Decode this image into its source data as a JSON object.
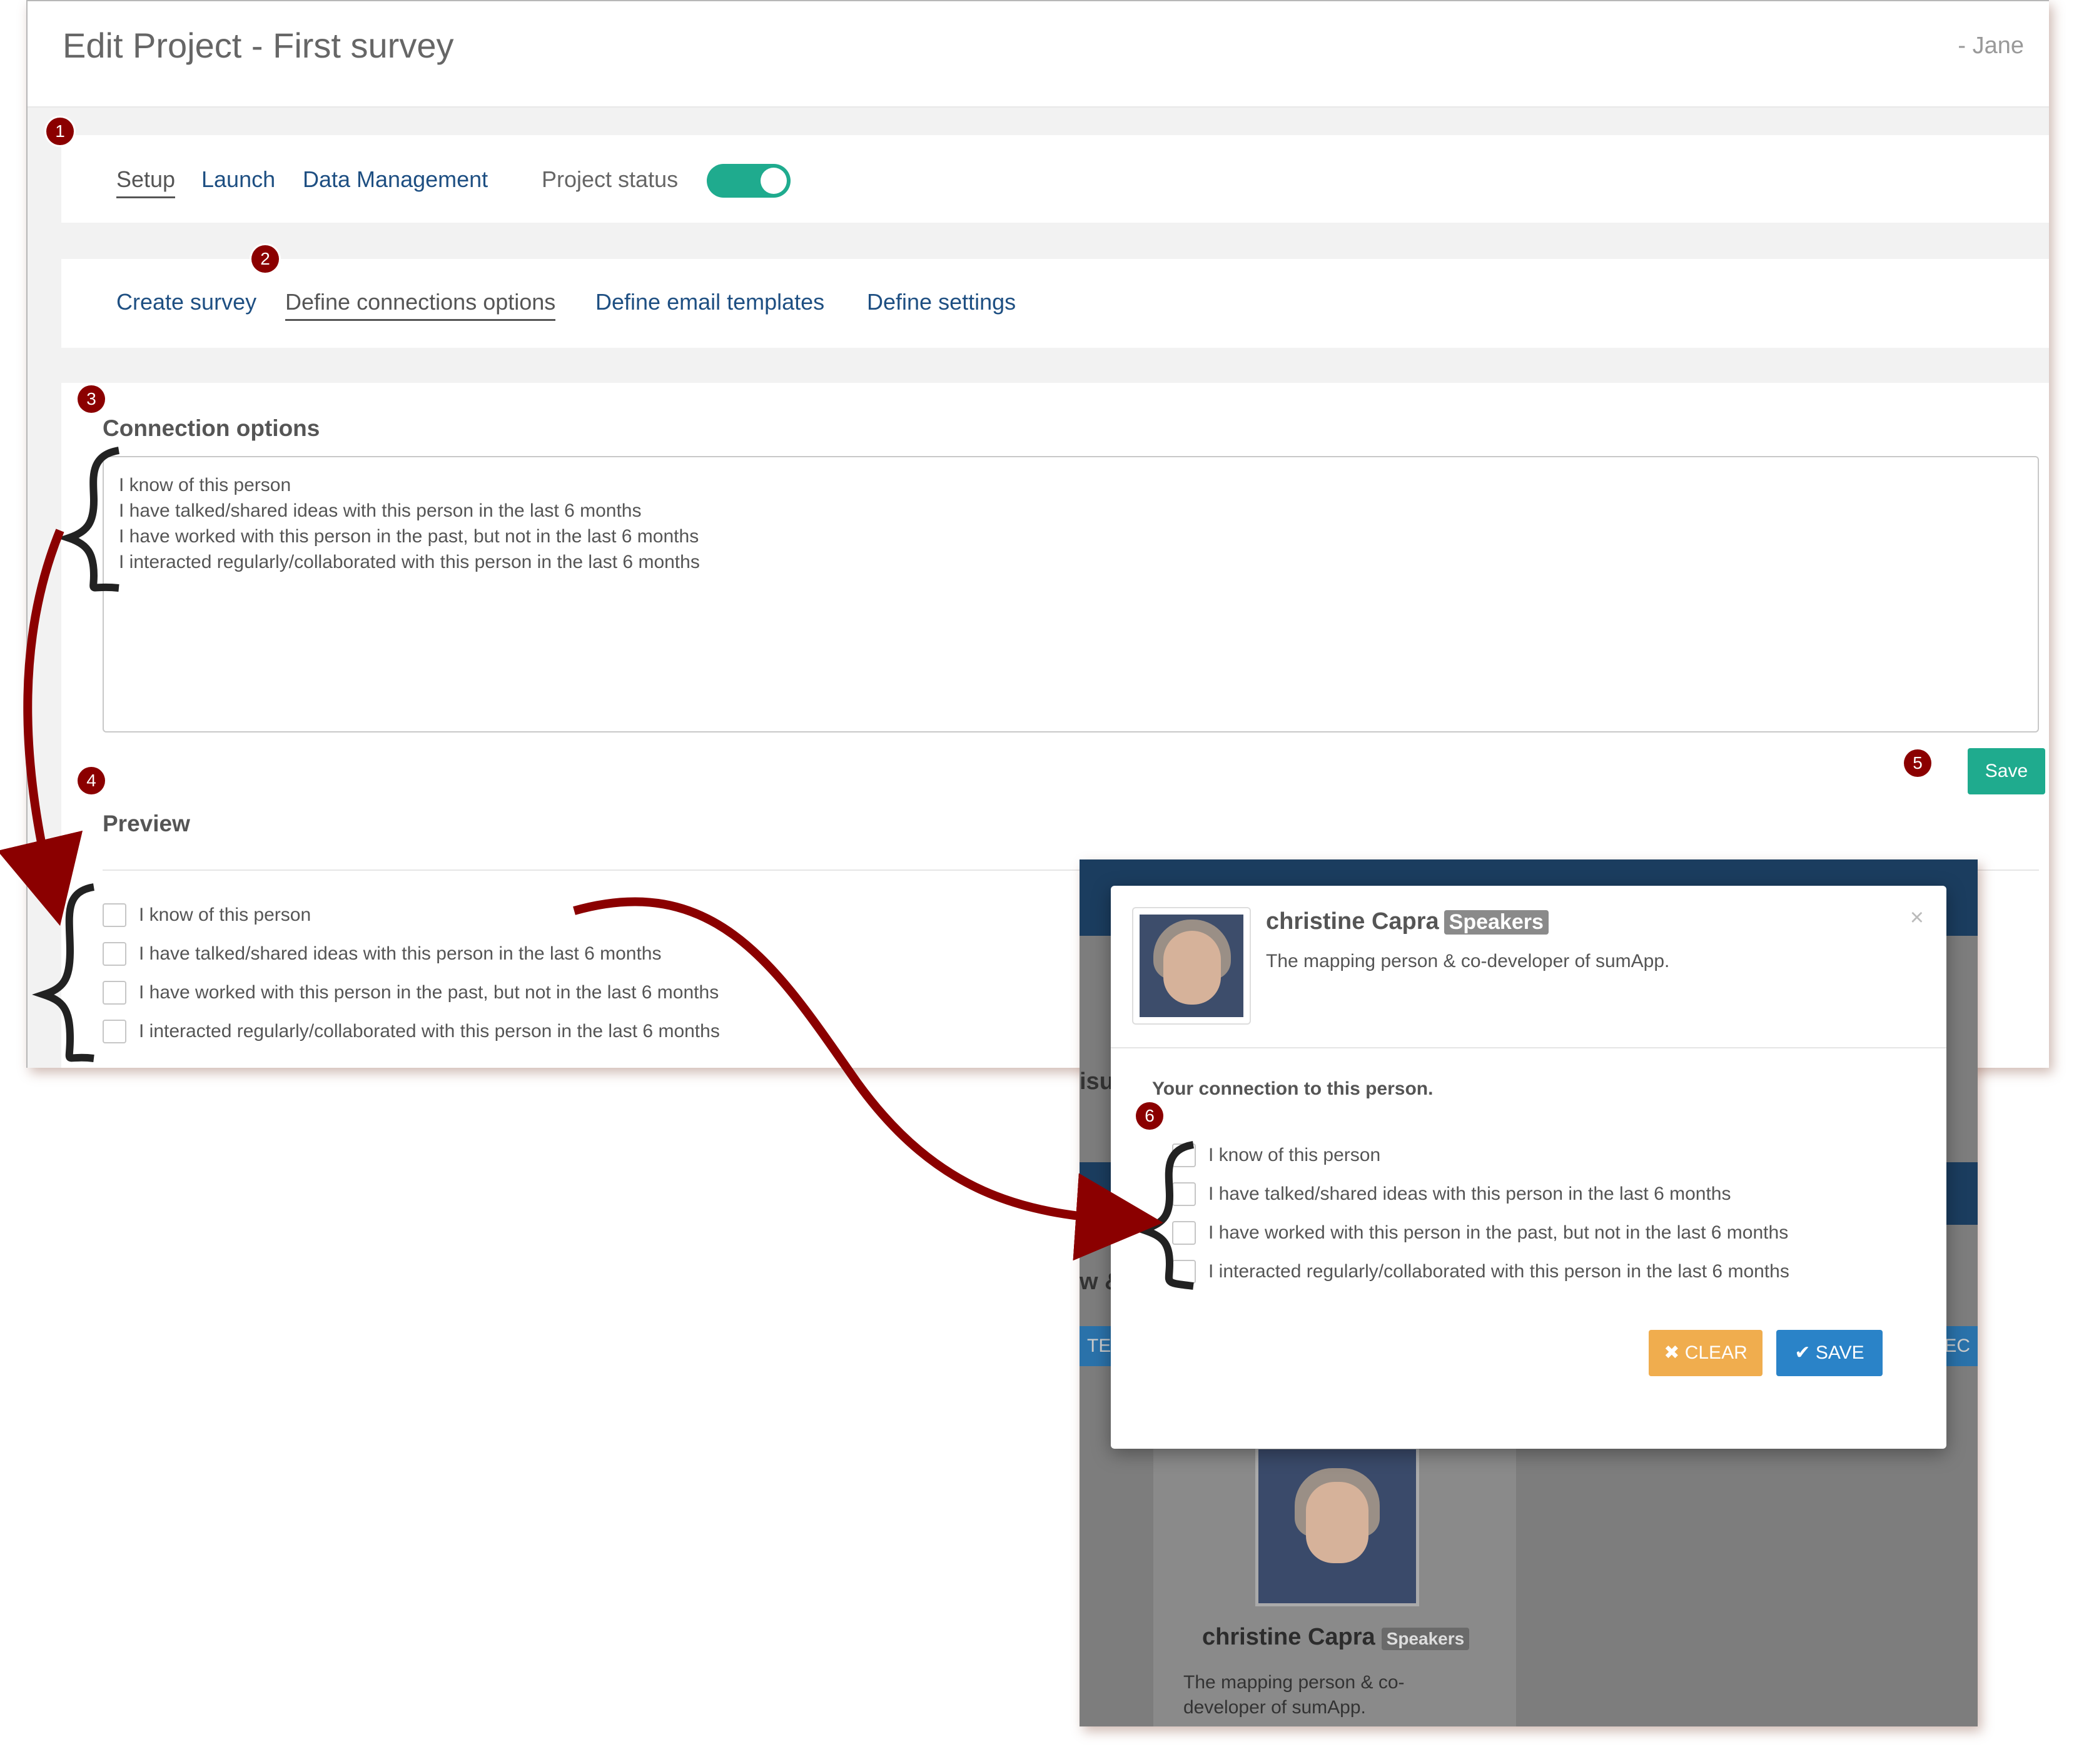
{
  "header": {
    "title": "Edit Project - First survey",
    "user": "- Jane"
  },
  "main_nav": {
    "items": [
      {
        "label": "Setup",
        "active": true
      },
      {
        "label": "Launch",
        "active": false
      },
      {
        "label": "Data Management",
        "active": false
      }
    ],
    "status_label": "Project status",
    "status_on": true
  },
  "sub_nav": {
    "items": [
      {
        "label": "Create survey",
        "active": false
      },
      {
        "label": "Define connections options",
        "active": true
      },
      {
        "label": "Define email templates",
        "active": false
      },
      {
        "label": "Define settings",
        "active": false
      }
    ]
  },
  "connection_options": {
    "heading": "Connection options",
    "lines": [
      "I know of this person",
      "I have talked/shared ideas with this person in the last 6 months",
      "I have worked with this person in the past, but not in the last 6 months",
      "I interacted regularly/collaborated with this person in the last 6 months"
    ],
    "save_label": "Save"
  },
  "preview": {
    "heading": "Preview",
    "options": [
      "I know of this person",
      "I have talked/shared ideas with this person in the last 6 months",
      "I have worked with this person in the past, but not in the last 6 months",
      "I interacted regularly/collaborated with this person in the last 6 months"
    ]
  },
  "modal": {
    "name": "christine Capra",
    "tag": "Speakers",
    "description": "The mapping person & co-developer of sumApp.",
    "close": "×",
    "connection_heading": "Your connection to this person.",
    "options": [
      "I know of this person",
      "I have talked/shared ideas with this person in the last 6 months",
      "I have worked with this person in the past, but not in the last 6 months",
      "I interacted regularly/collaborated with this person in the last 6 months"
    ],
    "clear_label": "✖ CLEAR",
    "save_label": "✔ SAVE"
  },
  "background_card": {
    "name": "christine Capra",
    "tag": "Speakers",
    "description": "The mapping person & co-developer of sumApp.",
    "ghost_1": "isu",
    "ghost_2": "w &",
    "ghost_btn_left": "TED",
    "ghost_btn_right": "EC"
  },
  "annotations": [
    "1",
    "2",
    "3",
    "4",
    "5",
    "6"
  ],
  "colors": {
    "primary_link": "#1e4f82",
    "accent_green": "#1fab8e",
    "badge_red": "#8b0000",
    "clear_orange": "#f0ad4e",
    "save_blue": "#2a83c8",
    "dark_navy": "#1b3d5f"
  }
}
